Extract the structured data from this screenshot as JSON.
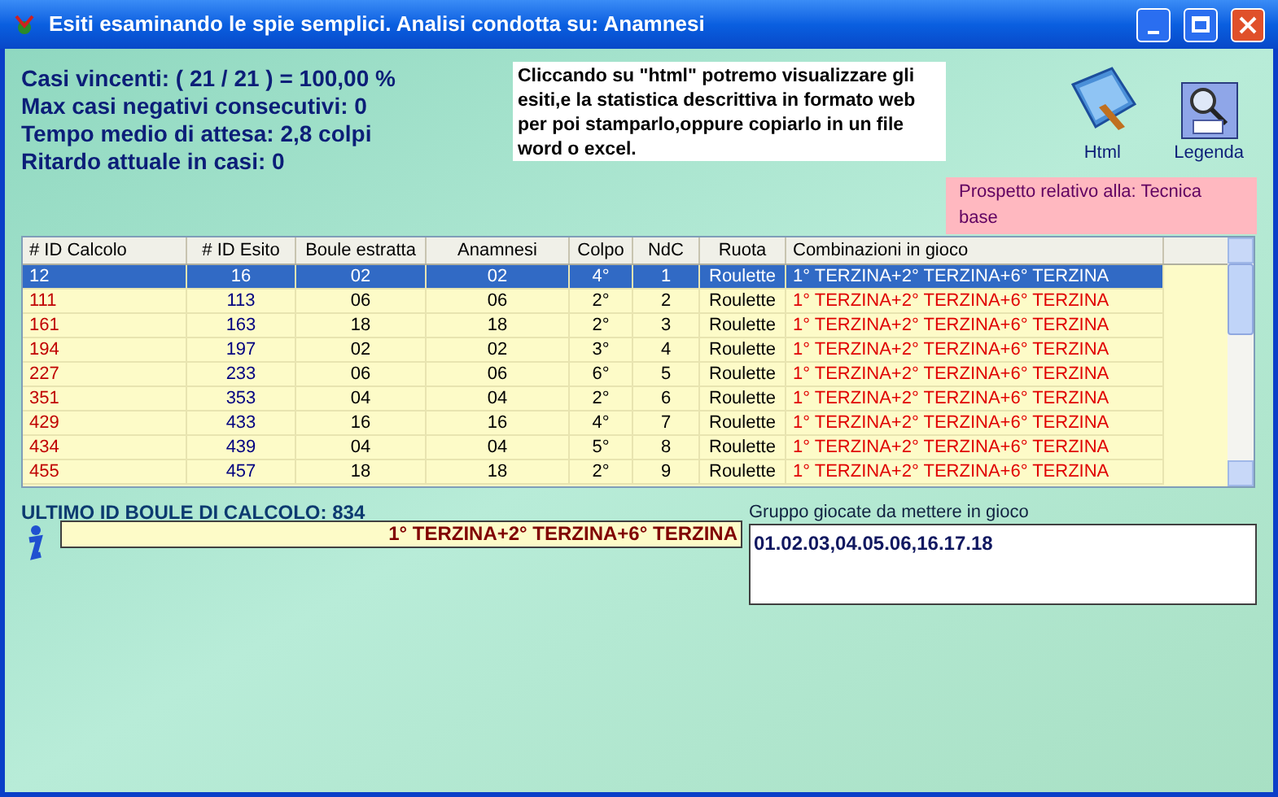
{
  "window": {
    "title": "Esiti esaminando le spie semplici. Analisi condotta su: Anamnesi"
  },
  "stats": [
    "Casi vincenti: ( 21 / 21 ) = 100,00 %",
    "Max casi negativi consecutivi: 0",
    "Tempo medio di attesa: 2,8 colpi",
    "Ritardo attuale in casi: 0"
  ],
  "info_note": "Cliccando su \"html\" potremo visualizzare gli esiti,e la statistica descrittiva in formato web per poi stamparlo,oppure copiarlo in un file word o excel.",
  "tools": [
    {
      "kind": "html",
      "label": "Html"
    },
    {
      "kind": "legend",
      "label": "Legenda"
    }
  ],
  "prospetto": "Prospetto relativo alla: Tecnica base",
  "table": {
    "columns": [
      "# ID Calcolo",
      "# ID Esito",
      "Boule estratta",
      "Anamnesi",
      "Colpo",
      "NdC",
      "Ruota",
      "Combinazioni in gioco"
    ],
    "rows": [
      {
        "selected": true,
        "cells": [
          "12",
          "16",
          "02",
          "02",
          "4°",
          "1",
          "Roulette",
          "1° TERZINA+2° TERZINA+6° TERZINA"
        ]
      },
      {
        "selected": false,
        "cells": [
          "111",
          "113",
          "06",
          "06",
          "2°",
          "2",
          "Roulette",
          "1° TERZINA+2° TERZINA+6° TERZINA"
        ]
      },
      {
        "selected": false,
        "cells": [
          "161",
          "163",
          "18",
          "18",
          "2°",
          "3",
          "Roulette",
          "1° TERZINA+2° TERZINA+6° TERZINA"
        ]
      },
      {
        "selected": false,
        "cells": [
          "194",
          "197",
          "02",
          "02",
          "3°",
          "4",
          "Roulette",
          "1° TERZINA+2° TERZINA+6° TERZINA"
        ]
      },
      {
        "selected": false,
        "cells": [
          "227",
          "233",
          "06",
          "06",
          "6°",
          "5",
          "Roulette",
          "1° TERZINA+2° TERZINA+6° TERZINA"
        ]
      },
      {
        "selected": false,
        "cells": [
          "351",
          "353",
          "04",
          "04",
          "2°",
          "6",
          "Roulette",
          "1° TERZINA+2° TERZINA+6° TERZINA"
        ]
      },
      {
        "selected": false,
        "cells": [
          "429",
          "433",
          "16",
          "16",
          "4°",
          "7",
          "Roulette",
          "1° TERZINA+2° TERZINA+6° TERZINA"
        ]
      },
      {
        "selected": false,
        "cells": [
          "434",
          "439",
          "04",
          "04",
          "5°",
          "8",
          "Roulette",
          "1° TERZINA+2° TERZINA+6° TERZINA"
        ]
      },
      {
        "selected": false,
        "cells": [
          "455",
          "457",
          "18",
          "18",
          "2°",
          "9",
          "Roulette",
          "1° TERZINA+2° TERZINA+6° TERZINA"
        ]
      }
    ]
  },
  "last_id": "ULTIMO  ID BOULE DI CALCOLO: 834",
  "combination": "1° TERZINA+2° TERZINA+6° TERZINA",
  "group": {
    "label": "Gruppo giocate da mettere in gioco",
    "value": "01.02.03,04.05.06,16.17.18"
  }
}
